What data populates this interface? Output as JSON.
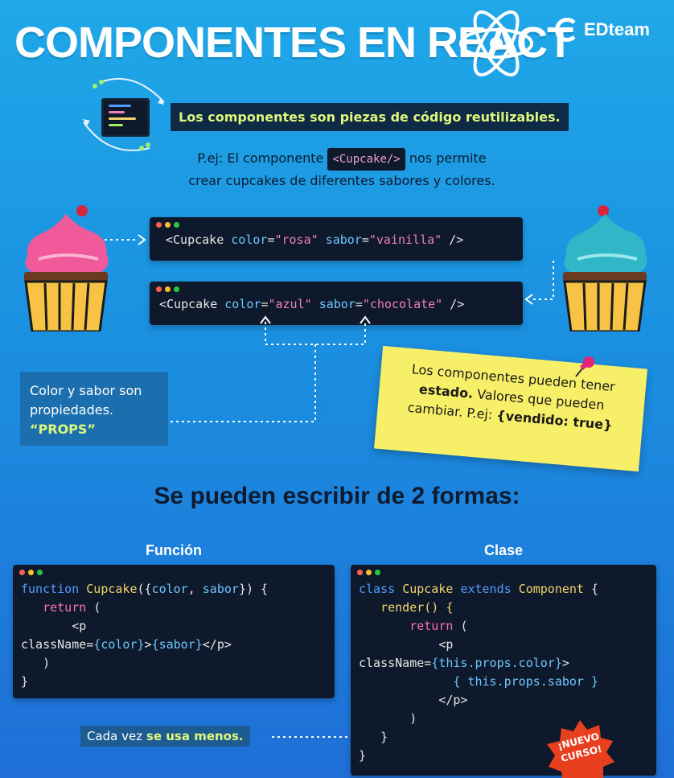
{
  "header": {
    "title": "COMPONENTES EN REACT",
    "brand": "EDteam"
  },
  "intro": {
    "headline": "Los componentes son piezas de código reutilizables.",
    "line1_a": "P.ej: El componente",
    "line1_chip": "<Cupcake/>",
    "line1_b": "nos permite",
    "line2": "crear cupcakes de diferentes sabores y colores."
  },
  "examples": [
    {
      "open": "<Cupcake",
      "attr1": "color",
      "val1": "\"rosa\"",
      "attr2": "sabor",
      "val2": "\"vainilla\"",
      "close": "/>"
    },
    {
      "open": "<Cupcake",
      "attr1": "color",
      "val1": "\"azul\"",
      "attr2": "sabor",
      "val2": "\"chocolate\"",
      "close": "/>"
    }
  ],
  "props_box": {
    "line1": "Color y sabor son",
    "line2": "propiedades.",
    "line3": "“PROPS”"
  },
  "note": {
    "l1": "Los componentes pueden tener",
    "l2_b": "estado.",
    "l2": "Valores que pueden",
    "l3": "cambiar. P.ej:",
    "l3_b": "{vendido: true}"
  },
  "ways_title": "Se pueden escribir de 2 formas:",
  "funcion": {
    "label": "Función",
    "l1_kw": "function",
    "l1_name": "Cupcake",
    "l1_a": "({",
    "l1_p1": "color",
    "l1_c": ", ",
    "l1_p2": "sabor",
    "l1_b": "}) {",
    "l2": "return",
    "l2b": "(",
    "l3": "<p",
    "l4_a": "className",
    "l4_b": "=",
    "l4_c": "{color}",
    "l4_d": ">",
    "l4_e": "{sabor}",
    "l4_f": "</p>",
    "l5": ")",
    "l6": "}"
  },
  "clase": {
    "label": "Clase",
    "l1_kw": "class",
    "l1_name": "Cupcake",
    "l1_ext": "extends",
    "l1_comp": "Component",
    "l1_b": "{",
    "l2": "render() {",
    "l3": "return",
    "l3b": "(",
    "l4": "<p",
    "l5_a": "className",
    "l5_b": "=",
    "l5_c": "{this.props.color}",
    "l5_d": ">",
    "l6": "{ this.props.sabor }",
    "l7": "</p>",
    "l8": ")",
    "l9": "}",
    "l10": "}"
  },
  "less_box": {
    "a": "Cada vez",
    "b": "se usa menos."
  },
  "badge": {
    "l1": "¡NUEVO",
    "l2": "CURSO!"
  },
  "colors": {
    "accent": "#dff77a",
    "note": "#f7ef68",
    "code_bg": "#0e1a2b",
    "badge": "#e8401f"
  }
}
